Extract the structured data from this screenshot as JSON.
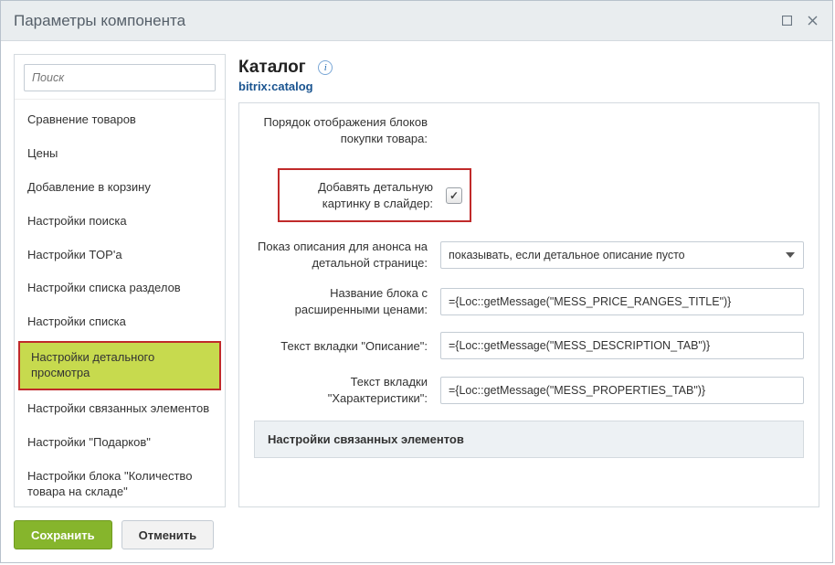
{
  "dialog": {
    "title": "Параметры компонента"
  },
  "sidebar": {
    "search_placeholder": "Поиск",
    "items": [
      {
        "label": "Сравнение товаров",
        "active": false
      },
      {
        "label": "Цены",
        "active": false
      },
      {
        "label": "Добавление в корзину",
        "active": false
      },
      {
        "label": "Настройки поиска",
        "active": false
      },
      {
        "label": "Настройки TOP'а",
        "active": false
      },
      {
        "label": "Настройки списка разделов",
        "active": false
      },
      {
        "label": "Настройки списка",
        "active": false
      },
      {
        "label": "Настройки детального просмотра",
        "active": true
      },
      {
        "label": "Настройки связанных элементов",
        "active": false
      },
      {
        "label": "Настройки \"Подарков\"",
        "active": false
      },
      {
        "label": "Настройки блока \"Количество товара на складе\"",
        "active": false
      }
    ]
  },
  "main": {
    "title": "Каталог",
    "subtitle": "bitrix:catalog",
    "info_glyph": "i",
    "blocks_order_label": "Порядок отображения блоков покупки товара:",
    "add_detail_picture_label": "Добавять детальную картинку в слайдер:",
    "add_detail_picture_checked": true,
    "main_block_picture_mode_label": "Показ описания для анонса на детальной странице:",
    "main_block_picture_mode_value": "показывать, если детальное описание пусто",
    "price_ranges_title_label": "Название блока с расширенными ценами:",
    "price_ranges_title_value": "={Loc::getMessage(\"MESS_PRICE_RANGES_TITLE\")}",
    "description_tab_label": "Текст вкладки \"Описание\":",
    "description_tab_value": "={Loc::getMessage(\"MESS_DESCRIPTION_TAB\")}",
    "properties_tab_label": "Текст вкладки \"Характеристики\":",
    "properties_tab_value": "={Loc::getMessage(\"MESS_PROPERTIES_TAB\")}",
    "related_section_title": "Настройки связанных элементов"
  },
  "footer": {
    "save": "Сохранить",
    "cancel": "Отменить"
  },
  "check_glyph": "✓"
}
